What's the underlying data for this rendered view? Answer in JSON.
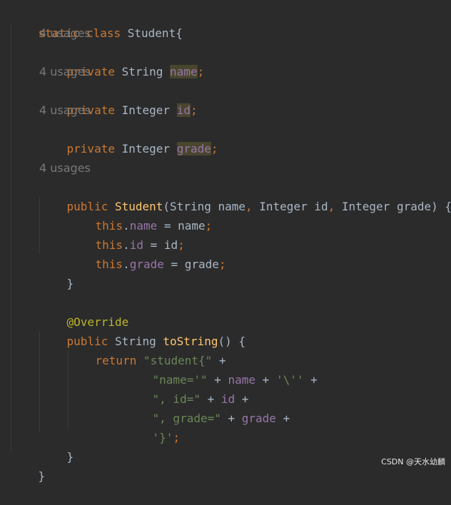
{
  "code": {
    "l1": {
      "kw": "static class",
      "name": "Student",
      "brace": "{"
    },
    "u1": "4 usages",
    "l3": {
      "kw": "private",
      "type": "String",
      "field": "name",
      "semi": ";"
    },
    "u2": "4 usages",
    "l5": {
      "kw": "private",
      "type": "Integer",
      "field": "id",
      "semi": ";"
    },
    "u3": "4 usages",
    "l7": {
      "kw": "private",
      "type": "Integer",
      "field": "grade",
      "semi": ";"
    },
    "u4": "4 usages",
    "l9": {
      "kw": "public",
      "name": "Student",
      "open": "(String name",
      "c1": ",",
      "p2": " Integer id",
      "c2": ",",
      "p3": " Integer grade) {"
    },
    "l10": {
      "this": "this",
      "dot": ".",
      "field": "name",
      "rest": " = name",
      "semi": ";"
    },
    "l11": {
      "this": "this",
      "dot": ".",
      "field": "id",
      "rest": " = id",
      "semi": ";"
    },
    "l12": {
      "this": "this",
      "dot": ".",
      "field": "grade",
      "rest": " = grade",
      "semi": ";"
    },
    "l13": "}",
    "l15": "@Override",
    "l16": {
      "kw": "public",
      "type": " String ",
      "fn": "toString",
      "rest": "() {"
    },
    "l17": {
      "kw": "return",
      "str": "\"student{\"",
      "rest": " +"
    },
    "l18": {
      "s1": "\"name='\"",
      "p1": " + ",
      "field": "name",
      "p2": " + ",
      "s2": "'\\''",
      "p3": " +"
    },
    "l19": {
      "s1": "\", id=\"",
      "p1": " + ",
      "field": "id",
      "p2": " +"
    },
    "l20": {
      "s1": "\", grade=\"",
      "p1": " + ",
      "field": "grade",
      "p2": " +"
    },
    "l21": {
      "s1": "'}'",
      "semi": ";"
    },
    "l22": "}",
    "l23": "}"
  },
  "watermark": "CSDN @天水幼麟"
}
